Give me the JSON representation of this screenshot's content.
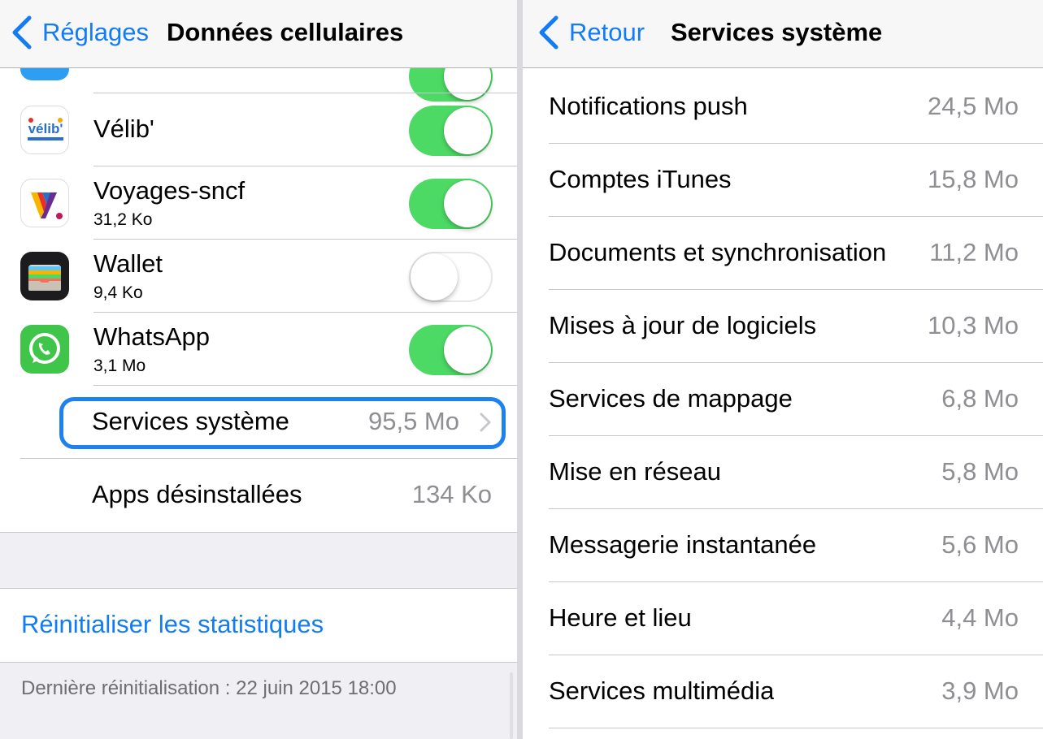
{
  "left": {
    "nav": {
      "back_label": "Réglages",
      "title": "Données cellulaires"
    },
    "apps": [
      {
        "name": "Vélib'",
        "sub": "",
        "on": true,
        "icon": "velib-icon"
      },
      {
        "name": "Voyages-sncf",
        "sub": "31,2 Ko",
        "on": true,
        "icon": "voyages-sncf-icon"
      },
      {
        "name": "Wallet",
        "sub": "9,4 Ko",
        "on": false,
        "icon": "wallet-icon"
      },
      {
        "name": "WhatsApp",
        "sub": "3,1 Mo",
        "on": true,
        "icon": "whatsapp-icon"
      }
    ],
    "velib_logo_text": "vélib'",
    "system_services": {
      "label": "Services système",
      "value": "95,5 Mo"
    },
    "uninstalled_apps": {
      "label": "Apps désinstallées",
      "value": "134 Ko"
    },
    "reset_label": "Réinitialiser les statistiques",
    "last_reset": "Dernière réinitialisation : 22 juin 2015 18:00"
  },
  "right": {
    "nav": {
      "back_label": "Retour",
      "title": "Services système"
    },
    "services": [
      {
        "name": "Notifications push",
        "value": "24,5 Mo"
      },
      {
        "name": "Comptes iTunes",
        "value": "15,8 Mo"
      },
      {
        "name": "Documents et synchronisation",
        "value": "11,2 Mo"
      },
      {
        "name": "Mises à jour de logiciels",
        "value": "10,3 Mo"
      },
      {
        "name": "Services de mappage",
        "value": "6,8 Mo"
      },
      {
        "name": "Mise en réseau",
        "value": "5,8 Mo"
      },
      {
        "name": "Messagerie instantanée",
        "value": "5,6 Mo"
      },
      {
        "name": "Heure et lieu",
        "value": "4,4 Mo"
      },
      {
        "name": "Services multimédia",
        "value": "3,9 Mo"
      }
    ]
  },
  "colors": {
    "ios_blue": "#127cf6",
    "toggle_on": "#4cd964",
    "value_gray": "#8e8e93",
    "highlight_border": "#1d82f0",
    "group_background": "#efeff4"
  }
}
